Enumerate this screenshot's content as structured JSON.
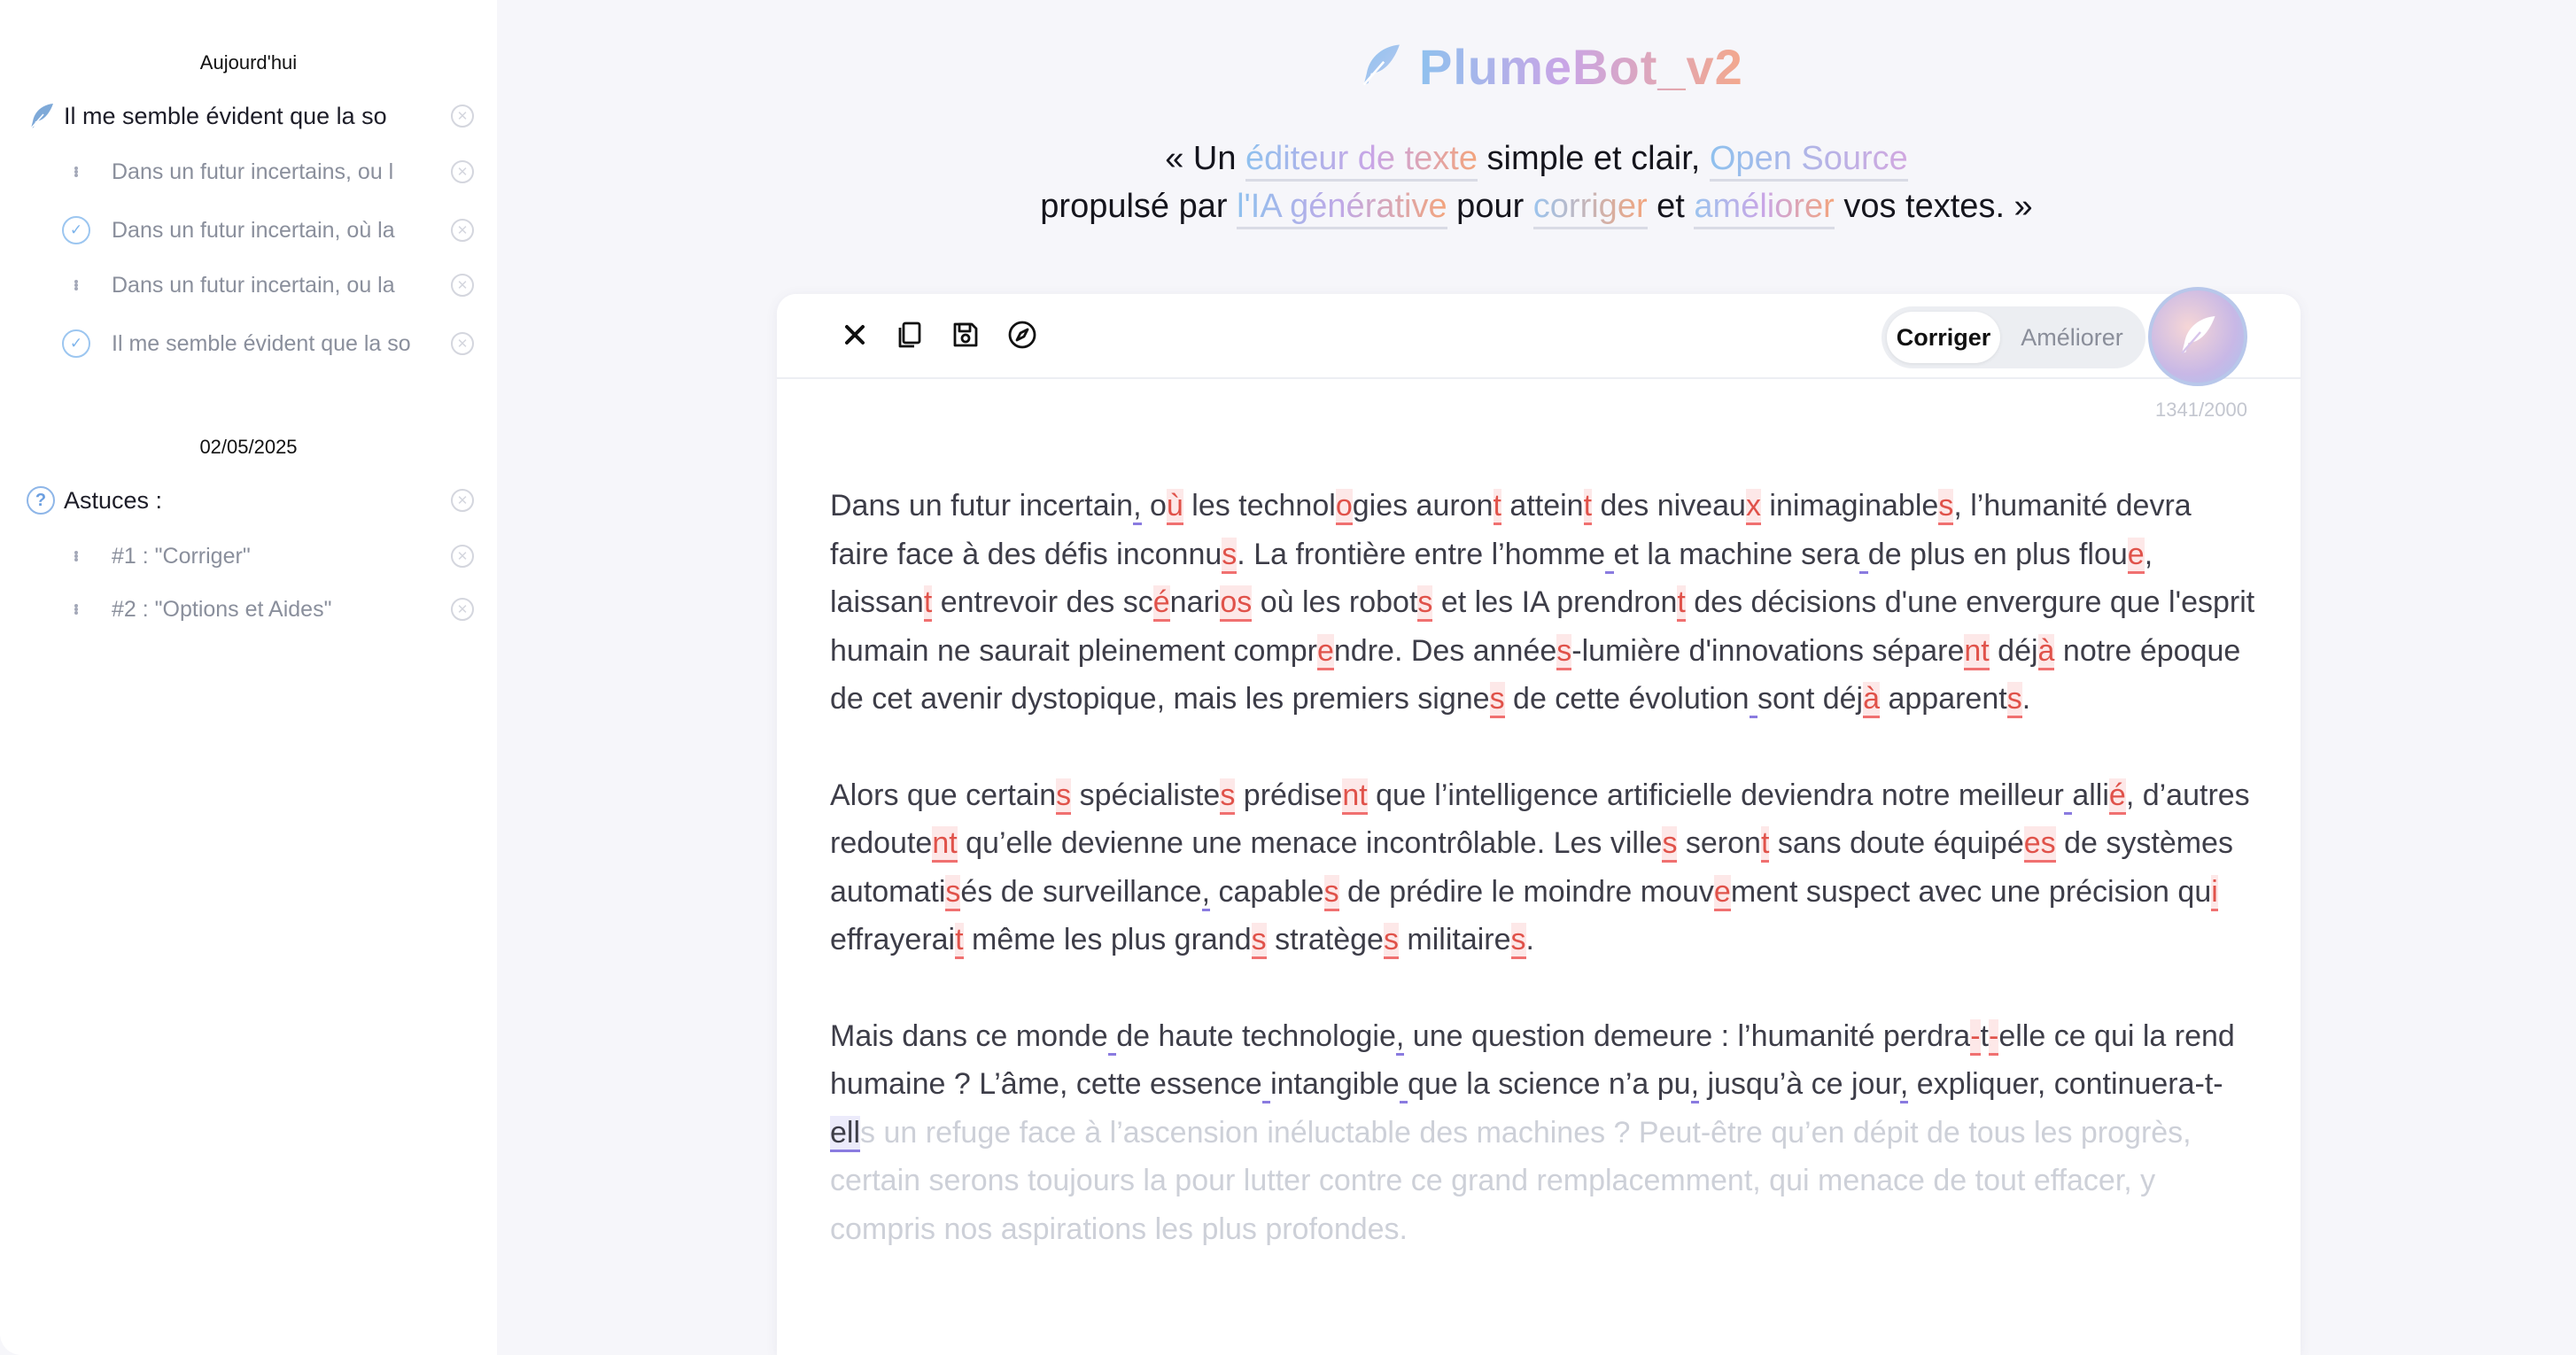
{
  "sidebar": {
    "today_label": "Aujourd'hui",
    "date_label": "02/05/2025",
    "today_items": [
      {
        "type": "main",
        "icon": "feather-icon",
        "label": "Il me semble évident que la so"
      },
      {
        "type": "sub",
        "icon": "drag-handle-icon",
        "label": "Dans un futur incertains, ou l"
      },
      {
        "type": "sub",
        "icon": "check-circle-icon",
        "label": "Dans un futur incertain, où la"
      },
      {
        "type": "sub",
        "icon": "drag-handle-icon",
        "label": "Dans un futur incertain, ou la"
      },
      {
        "type": "sub",
        "icon": "check-circle-icon",
        "label": "Il me semble évident que la so"
      }
    ],
    "date_items": [
      {
        "type": "main",
        "icon": "help-circle-icon",
        "label": "Astuces :"
      },
      {
        "type": "sub",
        "icon": "drag-handle-icon",
        "label": "#1 : \"Corriger\""
      },
      {
        "type": "sub",
        "icon": "drag-handle-icon",
        "label": "#2 : \"Options et Aides\""
      }
    ]
  },
  "header": {
    "brand": "PlumeBot_v2",
    "tagline": {
      "l1_a": "« Un ",
      "l1_hl1": "éditeur de texte",
      "l1_b": " simple et clair, ",
      "l1_hl2": "Open Source",
      "l2_a": "propulsé par ",
      "l2_hl1": "l'IA générative",
      "l2_b": " pour ",
      "l2_hl2": "corriger",
      "l2_c": " et ",
      "l2_hl3": "améliorer",
      "l2_d": " vos textes. »"
    }
  },
  "toolbar": {
    "clear_icon": "close-icon",
    "copy_icon": "copy-icon",
    "save_icon": "save-icon",
    "explore_icon": "compass-icon",
    "mode_correct": "Corriger",
    "mode_improve": "Améliorer",
    "counter": "1341/2000"
  },
  "colors": {
    "error": "#e0524a",
    "suggestion": "#8a7be0",
    "brand_blue": "#8fc1ee",
    "brand_orange": "#f3a88d"
  }
}
